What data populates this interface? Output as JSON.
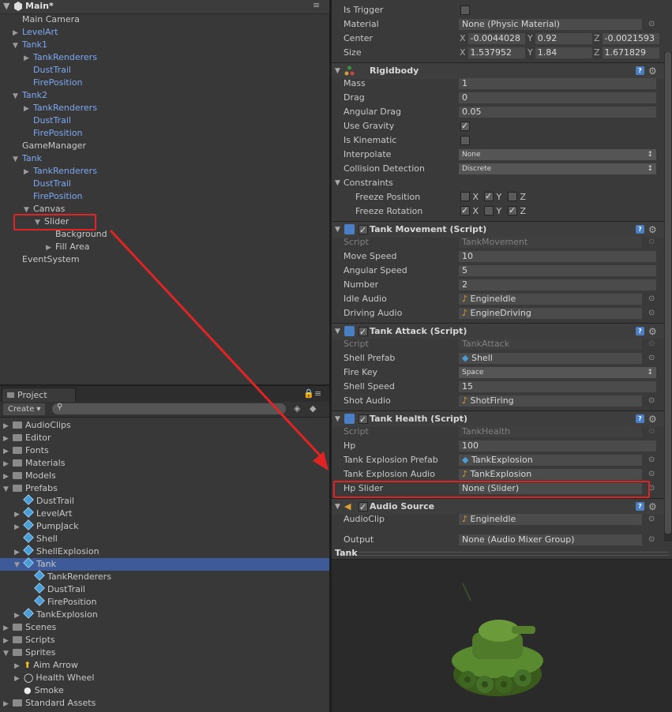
{
  "hierarchy": {
    "scene_title": "Main*",
    "items": [
      {
        "label": "Main Camera",
        "indent": 0,
        "arrow": "",
        "color": "white"
      },
      {
        "label": "LevelArt",
        "indent": 0,
        "arrow": "right",
        "color": "blue"
      },
      {
        "label": "Tank1",
        "indent": 0,
        "arrow": "down",
        "color": "blue"
      },
      {
        "label": "TankRenderers",
        "indent": 1,
        "arrow": "right",
        "color": "blue"
      },
      {
        "label": "DustTrail",
        "indent": 1,
        "arrow": "",
        "color": "blue"
      },
      {
        "label": "FirePosition",
        "indent": 1,
        "arrow": "",
        "color": "blue"
      },
      {
        "label": "Tank2",
        "indent": 0,
        "arrow": "down",
        "color": "blue"
      },
      {
        "label": "TankRenderers",
        "indent": 1,
        "arrow": "right",
        "color": "blue"
      },
      {
        "label": "DustTrail",
        "indent": 1,
        "arrow": "",
        "color": "blue"
      },
      {
        "label": "FirePosition",
        "indent": 1,
        "arrow": "",
        "color": "blue"
      },
      {
        "label": "GameManager",
        "indent": 0,
        "arrow": "",
        "color": "white"
      },
      {
        "label": "Tank",
        "indent": 0,
        "arrow": "down",
        "color": "blue"
      },
      {
        "label": "TankRenderers",
        "indent": 1,
        "arrow": "right",
        "color": "blue"
      },
      {
        "label": "DustTrail",
        "indent": 1,
        "arrow": "",
        "color": "blue"
      },
      {
        "label": "FirePosition",
        "indent": 1,
        "arrow": "",
        "color": "blue"
      },
      {
        "label": "Canvas",
        "indent": 1,
        "arrow": "down",
        "color": "white"
      },
      {
        "label": "Slider",
        "indent": 2,
        "arrow": "down",
        "color": "white"
      },
      {
        "label": "Background",
        "indent": 3,
        "arrow": "",
        "color": "white"
      },
      {
        "label": "Fill Area",
        "indent": 3,
        "arrow": "right",
        "color": "white"
      },
      {
        "label": "EventSystem",
        "indent": 0,
        "arrow": "",
        "color": "white"
      }
    ]
  },
  "project": {
    "tab": "Project",
    "create_label": "Create",
    "items": [
      {
        "label": "AudioClips",
        "indent": 0,
        "arrow": "right",
        "kind": "folder"
      },
      {
        "label": "Editor",
        "indent": 0,
        "arrow": "right",
        "kind": "folder"
      },
      {
        "label": "Fonts",
        "indent": 0,
        "arrow": "right",
        "kind": "folder"
      },
      {
        "label": "Materials",
        "indent": 0,
        "arrow": "right",
        "kind": "folder"
      },
      {
        "label": "Models",
        "indent": 0,
        "arrow": "right",
        "kind": "folder"
      },
      {
        "label": "Prefabs",
        "indent": 0,
        "arrow": "down",
        "kind": "folder"
      },
      {
        "label": "DustTrail",
        "indent": 1,
        "arrow": "",
        "kind": "prefab"
      },
      {
        "label": "LevelArt",
        "indent": 1,
        "arrow": "right",
        "kind": "prefab"
      },
      {
        "label": "PumpJack",
        "indent": 1,
        "arrow": "right",
        "kind": "prefab"
      },
      {
        "label": "Shell",
        "indent": 1,
        "arrow": "",
        "kind": "prefab"
      },
      {
        "label": "ShellExplosion",
        "indent": 1,
        "arrow": "right",
        "kind": "prefab"
      },
      {
        "label": "Tank",
        "indent": 1,
        "arrow": "down",
        "kind": "prefab",
        "selected": true
      },
      {
        "label": "TankRenderers",
        "indent": 2,
        "arrow": "",
        "kind": "prefab"
      },
      {
        "label": "DustTrail",
        "indent": 2,
        "arrow": "",
        "kind": "prefab"
      },
      {
        "label": "FirePosition",
        "indent": 2,
        "arrow": "",
        "kind": "prefab"
      },
      {
        "label": "TankExplosion",
        "indent": 1,
        "arrow": "right",
        "kind": "prefab"
      },
      {
        "label": "Scenes",
        "indent": 0,
        "arrow": "right",
        "kind": "folder"
      },
      {
        "label": "Scripts",
        "indent": 0,
        "arrow": "right",
        "kind": "folder"
      },
      {
        "label": "Sprites",
        "indent": 0,
        "arrow": "down",
        "kind": "folder"
      },
      {
        "label": "Aim Arrow",
        "indent": 1,
        "arrow": "right",
        "kind": "arrow"
      },
      {
        "label": "Health Wheel",
        "indent": 1,
        "arrow": "right",
        "kind": "ring"
      },
      {
        "label": "Smoke",
        "indent": 1,
        "arrow": "",
        "kind": "dot"
      },
      {
        "label": "Standard Assets",
        "indent": 0,
        "arrow": "right",
        "kind": "folder"
      }
    ]
  },
  "inspector": {
    "box_collider": {
      "is_trigger": "Is Trigger",
      "material_label": "Material",
      "material_value": "None (Physic Material)",
      "center_label": "Center",
      "center": {
        "x": "-0.0044028",
        "y": "0.92",
        "z": "-0.0021593"
      },
      "size_label": "Size",
      "size": {
        "x": "1.537952",
        "y": "1.84",
        "z": "1.671829"
      }
    },
    "rigidbody": {
      "title": "Rigidbody",
      "mass_label": "Mass",
      "mass": "1",
      "drag_label": "Drag",
      "drag": "0",
      "angular_drag_label": "Angular Drag",
      "angular_drag": "0.05",
      "use_gravity_label": "Use Gravity",
      "is_kinematic_label": "Is Kinematic",
      "interpolate_label": "Interpolate",
      "interpolate": "None",
      "collision_label": "Collision Detection",
      "collision": "Discrete",
      "constraints_label": "Constraints",
      "freeze_pos_label": "Freeze Position",
      "freeze_rot_label": "Freeze Rotation",
      "x": "X",
      "y": "Y",
      "z": "Z"
    },
    "tank_movement": {
      "title": "Tank Movement (Script)",
      "script_label": "Script",
      "script": "TankMovement",
      "move_speed_label": "Move Speed",
      "move_speed": "10",
      "angular_speed_label": "Angular Speed",
      "angular_speed": "5",
      "number_label": "Number",
      "number": "2",
      "idle_audio_label": "Idle Audio",
      "idle_audio": "EngineIdle",
      "driving_audio_label": "Driving Audio",
      "driving_audio": "EngineDriving"
    },
    "tank_attack": {
      "title": "Tank Attack (Script)",
      "script_label": "Script",
      "script": "TankAttack",
      "shell_prefab_label": "Shell Prefab",
      "shell_prefab": "Shell",
      "fire_key_label": "Fire Key",
      "fire_key": "Space",
      "shell_speed_label": "Shell Speed",
      "shell_speed": "15",
      "shot_audio_label": "Shot Audio",
      "shot_audio": "ShotFiring"
    },
    "tank_health": {
      "title": "Tank Health (Script)",
      "script_label": "Script",
      "script": "TankHealth",
      "hp_label": "Hp",
      "hp": "100",
      "explosion_prefab_label": "Tank Explosion Prefab",
      "explosion_prefab": "TankExplosion",
      "explosion_audio_label": "Tank Explosion Audio",
      "explosion_audio": "TankExplosion",
      "hp_slider_label": "Hp Slider",
      "hp_slider": "None (Slider)"
    },
    "audio_source": {
      "title": "Audio Source",
      "clip_label": "AudioClip",
      "clip": "EngineIdle",
      "output_label": "Output",
      "output": "None (Audio Mixer Group)"
    }
  },
  "preview": {
    "title": "Tank"
  },
  "colors": {
    "accent_red": "#e02424",
    "selection": "#3e5a99",
    "link_blue": "#7fa8f0",
    "tank_green": "#4f7a2a"
  }
}
